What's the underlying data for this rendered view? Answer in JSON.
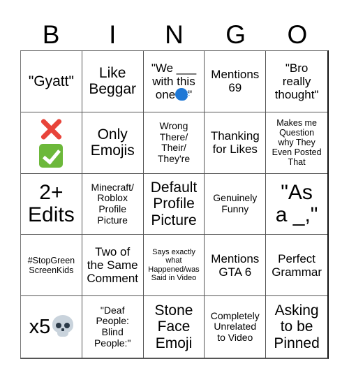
{
  "header": {
    "letters": [
      "B",
      "I",
      "N",
      "G",
      "O"
    ]
  },
  "board": {
    "cells": [
      {
        "text": "\"Gyatt\""
      },
      {
        "text": "Like\nBeggar"
      },
      {
        "text_before": "\"We ___\nwith this\none",
        "icon": "speaking-head-icon",
        "text_after": "\""
      },
      {
        "text": "Mentions\n69"
      },
      {
        "text": "\"Bro\nreally\nthought\""
      },
      {
        "icons": [
          "cross-mark-icon",
          "check-mark-button-icon"
        ]
      },
      {
        "text": "Only\nEmojis"
      },
      {
        "text": "Wrong\nThere/\nTheir/\nThey're"
      },
      {
        "text": "Thanking\nfor Likes"
      },
      {
        "text": "Makes me\nQuestion\nwhy They\nEven Posted\nThat"
      },
      {
        "text": "2+\nEdits"
      },
      {
        "text": "Minecraft/\nRoblox\nProfile\nPicture"
      },
      {
        "text": "Default\nProfile\nPicture"
      },
      {
        "text": "Genuinely\nFunny"
      },
      {
        "text": "\"As\na _,\""
      },
      {
        "text": "#StopGreen\nScreenKids"
      },
      {
        "text": "Two of\nthe Same\nComment"
      },
      {
        "text": "Says exactly\nwhat\nHappened/was\nSaid in Video"
      },
      {
        "text": "Mentions\nGTA 6"
      },
      {
        "text": "Perfect\nGrammar"
      },
      {
        "text": "x5",
        "icon": "skull-icon"
      },
      {
        "text": "\"Deaf\nPeople:\nBlind\nPeople:\""
      },
      {
        "text": "Stone\nFace\nEmoji"
      },
      {
        "text": "Completely\nUnrelated\nto Video"
      },
      {
        "text": "Asking\nto be\nPinned"
      }
    ]
  }
}
